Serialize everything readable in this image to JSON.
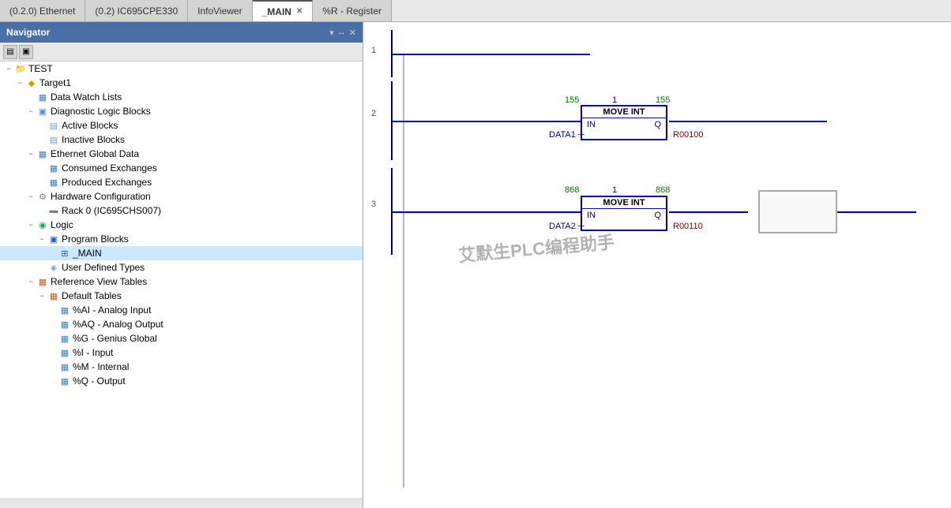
{
  "tabs": [
    {
      "label": "(0.2.0) Ethernet",
      "active": false,
      "closable": false
    },
    {
      "label": "(0.2) IC695CPE330",
      "active": false,
      "closable": false
    },
    {
      "label": "InfoViewer",
      "active": false,
      "closable": false
    },
    {
      "label": "_MAIN",
      "active": true,
      "closable": true
    },
    {
      "label": "%R - Register",
      "active": false,
      "closable": false
    }
  ],
  "navigator": {
    "title": "Navigator",
    "icons": [
      "▾",
      "↔",
      "×"
    ],
    "tree": [
      {
        "id": "test",
        "label": "TEST",
        "indent": 0,
        "expand": "−",
        "icon": "folder",
        "iconSymbol": "📁"
      },
      {
        "id": "target1",
        "label": "Target1",
        "indent": 1,
        "expand": "−",
        "icon": "target",
        "iconSymbol": "◆"
      },
      {
        "id": "datawatchlists",
        "label": "Data Watch Lists",
        "indent": 2,
        "expand": "",
        "icon": "list",
        "iconSymbol": "▦"
      },
      {
        "id": "diaglogicblocks",
        "label": "Diagnostic Logic Blocks",
        "indent": 2,
        "expand": "−",
        "icon": "block",
        "iconSymbol": "▣"
      },
      {
        "id": "activeblocks",
        "label": "Active Blocks",
        "indent": 3,
        "expand": "",
        "icon": "sub",
        "iconSymbol": "▤"
      },
      {
        "id": "inactiveblocks",
        "label": "Inactive Blocks",
        "indent": 3,
        "expand": "",
        "icon": "sub",
        "iconSymbol": "▤"
      },
      {
        "id": "ethernetglobal",
        "label": "Ethernet Global Data",
        "indent": 2,
        "expand": "−",
        "icon": "grid",
        "iconSymbol": "▦"
      },
      {
        "id": "consumed",
        "label": "Consumed Exchanges",
        "indent": 3,
        "expand": "",
        "icon": "grid",
        "iconSymbol": "▦"
      },
      {
        "id": "produced",
        "label": "Produced Exchanges",
        "indent": 3,
        "expand": "",
        "icon": "grid",
        "iconSymbol": "▦"
      },
      {
        "id": "hardwareconfig",
        "label": "Hardware Configuration",
        "indent": 2,
        "expand": "−",
        "icon": "gear",
        "iconSymbol": "⚙"
      },
      {
        "id": "rack0",
        "label": "Rack 0 (IC695CHS007)",
        "indent": 3,
        "expand": "",
        "icon": "rack",
        "iconSymbol": "▬"
      },
      {
        "id": "logic",
        "label": "Logic",
        "indent": 2,
        "expand": "−",
        "icon": "logic",
        "iconSymbol": "◉"
      },
      {
        "id": "programblocks",
        "label": "Program Blocks",
        "indent": 3,
        "expand": "−",
        "icon": "prog",
        "iconSymbol": "▣"
      },
      {
        "id": "main",
        "label": "_MAIN",
        "indent": 4,
        "expand": "",
        "icon": "main",
        "iconSymbol": "⊞",
        "selected": true
      },
      {
        "id": "userdefinedtypes",
        "label": "User Defined Types",
        "indent": 3,
        "expand": "",
        "icon": "sub",
        "iconSymbol": "◈"
      },
      {
        "id": "refviewtables",
        "label": "Reference View Tables",
        "indent": 2,
        "expand": "−",
        "icon": "ref",
        "iconSymbol": "▦"
      },
      {
        "id": "defaulttables",
        "label": "Default Tables",
        "indent": 3,
        "expand": "−",
        "icon": "table",
        "iconSymbol": "▦"
      },
      {
        "id": "analoginput",
        "label": "%AI - Analog Input",
        "indent": 4,
        "expand": "",
        "icon": "reg",
        "iconSymbol": "▦"
      },
      {
        "id": "analogoutput",
        "label": "%AQ - Analog Output",
        "indent": 4,
        "expand": "",
        "icon": "reg",
        "iconSymbol": "▦"
      },
      {
        "id": "geniusglobal",
        "label": "%G - Genius Global",
        "indent": 4,
        "expand": "",
        "icon": "reg",
        "iconSymbol": "▦"
      },
      {
        "id": "input",
        "label": "%I - Input",
        "indent": 4,
        "expand": "",
        "icon": "reg",
        "iconSymbol": "▦"
      },
      {
        "id": "internal",
        "label": "%M - Internal",
        "indent": 4,
        "expand": "",
        "icon": "reg",
        "iconSymbol": "▦"
      },
      {
        "id": "output",
        "label": "%Q - Output",
        "indent": 4,
        "expand": "",
        "icon": "reg",
        "iconSymbol": "▦"
      }
    ]
  },
  "ladder": {
    "rungs": [
      {
        "number": "1"
      },
      {
        "number": "2",
        "block": {
          "title": "MOVE INT",
          "in_val": "155",
          "out_val": "155",
          "mid_val": "1",
          "data_label": "DATA1",
          "output_label": "R00100"
        }
      },
      {
        "number": "3",
        "block": {
          "title": "MOVE INT",
          "in_val": "868",
          "out_val": "868",
          "mid_val": "1",
          "data_label": "DATA2",
          "output_label": "R00110"
        }
      }
    ],
    "watermark": "艾默生PLC编程助手"
  }
}
